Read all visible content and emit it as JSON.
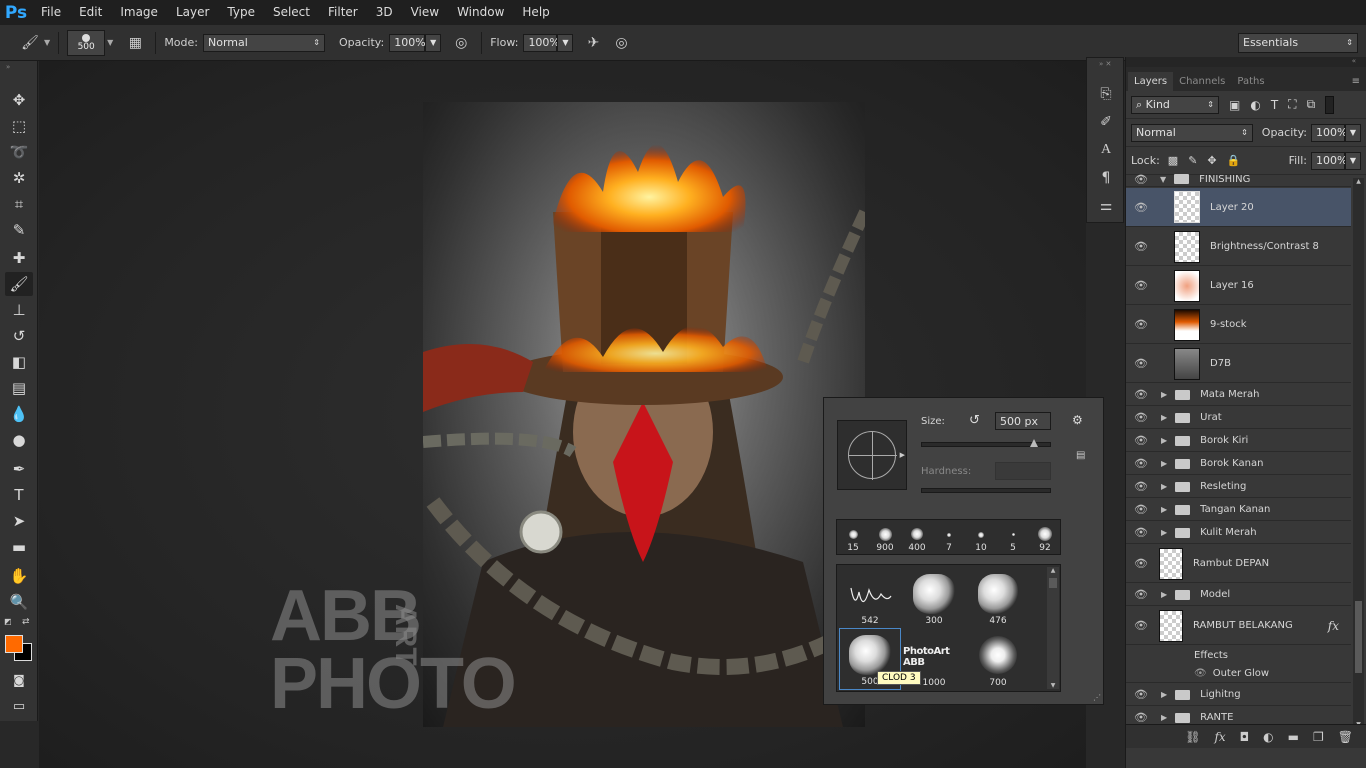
{
  "app": {
    "logo": "Ps"
  },
  "menu": [
    "File",
    "Edit",
    "Image",
    "Layer",
    "Type",
    "Select",
    "Filter",
    "3D",
    "View",
    "Window",
    "Help"
  ],
  "options": {
    "brush_size": "500",
    "mode_label": "Mode:",
    "mode_value": "Normal",
    "opacity_label": "Opacity:",
    "opacity_value": "100%",
    "flow_label": "Flow:",
    "flow_value": "100%",
    "workspace": "Essentials"
  },
  "colors": {
    "foreground": "#ff6a00",
    "background": "#000000",
    "accent": "#31a8ff"
  },
  "watermark": {
    "line1": "ABB",
    "line2": "PHOTO",
    "vertical": "ART"
  },
  "brush_panel": {
    "size_label": "Size:",
    "size_value": "500 px",
    "hardness_label": "Hardness:",
    "size_slider_fraction": 0.9,
    "recent_sizes": [
      "15",
      "900",
      "400",
      "7",
      "10",
      "5",
      "92"
    ],
    "presets": [
      {
        "label": "542",
        "kind": "signature"
      },
      {
        "label": "300",
        "kind": "cloud"
      },
      {
        "label": "476",
        "kind": "cloud"
      },
      {
        "label": "500",
        "kind": "cloud"
      },
      {
        "label": "1000",
        "kind": "text",
        "text": "PhotoArt ABB"
      },
      {
        "label": "700",
        "kind": "glow"
      }
    ],
    "tooltip": "CLOD 3"
  },
  "layers_panel": {
    "tabs": [
      "Layers",
      "Channels",
      "Paths"
    ],
    "filter_kind": "Kind",
    "blend_mode": "Normal",
    "opacity_label": "Opacity:",
    "opacity_value": "100%",
    "lock_label": "Lock:",
    "fill_label": "Fill:",
    "fill_value": "100%",
    "layers": [
      {
        "name": "FINISHING",
        "type": "group-open"
      },
      {
        "name": "Layer 20",
        "type": "layer",
        "selected": true
      },
      {
        "name": "Brightness/Contrast 8",
        "type": "layer"
      },
      {
        "name": "Layer 16",
        "type": "layer"
      },
      {
        "name": "9-stock",
        "type": "layer"
      },
      {
        "name": "D7B",
        "type": "layer"
      },
      {
        "name": "Mata Merah",
        "type": "group"
      },
      {
        "name": "Urat",
        "type": "group"
      },
      {
        "name": "Borok Kiri",
        "type": "group"
      },
      {
        "name": "Borok Kanan",
        "type": "group"
      },
      {
        "name": "Resleting",
        "type": "group"
      },
      {
        "name": "Tangan Kanan",
        "type": "group"
      },
      {
        "name": "Kulit Merah",
        "type": "group"
      },
      {
        "name": "Rambut DEPAN",
        "type": "layer"
      },
      {
        "name": "Model",
        "type": "group"
      },
      {
        "name": "RAMBUT BELAKANG",
        "type": "layer-fx"
      },
      {
        "name": "Effects",
        "type": "effects"
      },
      {
        "name": "Outer Glow",
        "type": "effect"
      },
      {
        "name": "Lighitng",
        "type": "group"
      },
      {
        "name": "RANTE",
        "type": "group"
      }
    ],
    "fx_label": "fx"
  }
}
